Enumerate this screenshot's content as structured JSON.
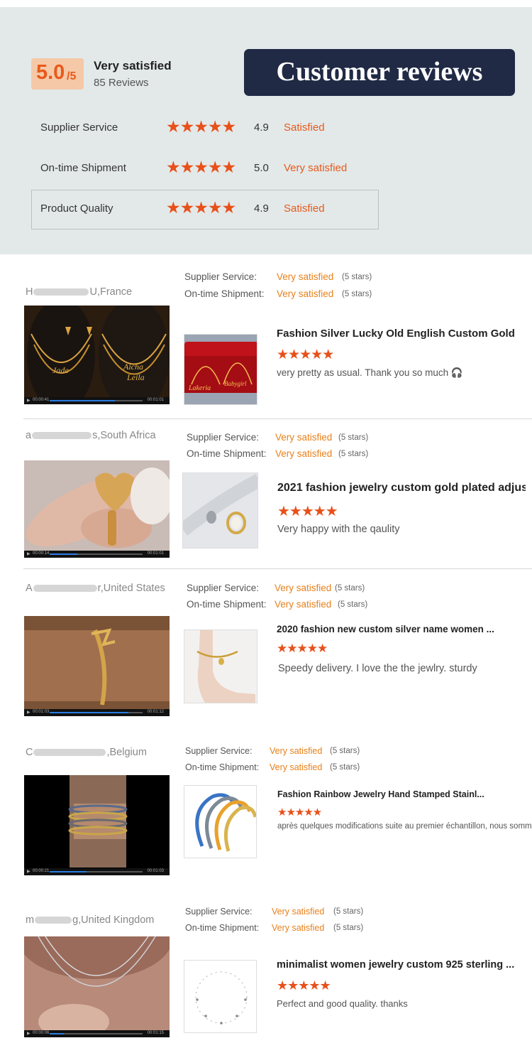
{
  "summary": {
    "score": "5.0",
    "score_suffix": "/5",
    "overall_label": "Very satisfied",
    "review_count": "85 Reviews",
    "banner": "Customer reviews",
    "ratings": [
      {
        "label": "Supplier Service",
        "stars": "★★★★★",
        "score": "4.9",
        "status": "Satisfied"
      },
      {
        "label": "On-time Shipment",
        "stars": "★★★★★",
        "score": "5.0",
        "status": "Very satisfied"
      },
      {
        "label": "Product Quality",
        "stars": "★★★★★",
        "score": "4.9",
        "status": "Satisfied"
      }
    ]
  },
  "reviews": [
    {
      "reviewer_initial": "H",
      "reviewer_tail": "U,France",
      "supplier_label": "Supplier Service:",
      "supplier_status": "Very satisfied",
      "supplier_stars": "(5 stars)",
      "shipment_label": "On-time Shipment:",
      "shipment_status": "Very satisfied",
      "shipment_stars": "(5 stars)",
      "product_title": "Fashion Silver Lucky Old English Custom Gold ...",
      "stars": "★★★★★",
      "comment": "very pretty as usual. Thank you so much 🎧",
      "video_start": "00:00:41",
      "video_end": "00:01:01",
      "video_progress": 0.7
    },
    {
      "reviewer_initial": "a",
      "reviewer_tail": "s,South Africa",
      "supplier_label": "Supplier Service:",
      "supplier_status": "Very satisfied",
      "supplier_stars": "(5 stars)",
      "shipment_label": "On-time Shipment:",
      "shipment_status": "Very satisfied",
      "shipment_stars": "(5 stars)",
      "product_title": "2021 fashion jewelry custom gold plated adjus...",
      "stars": "★★★★★",
      "comment": "Very happy with the qaulity",
      "video_start": "00:00:14",
      "video_end": "00:01:01",
      "video_progress": 0.3
    },
    {
      "reviewer_initial": "A",
      "reviewer_tail": "r,United States",
      "supplier_label": "Supplier Service:",
      "supplier_status": "Very satisfied",
      "supplier_stars": "(5 stars)",
      "shipment_label": "On-time Shipment:",
      "shipment_status": "Very satisfied",
      "shipment_stars": "(5 stars)",
      "product_title": "2020 fashion new custom silver name women ...",
      "stars": "★★★★★",
      "comment": "Speedy delivery. I love the the jewlry. sturdy",
      "video_start": "00:01:03",
      "video_end": "00:01:12",
      "video_progress": 0.85
    },
    {
      "reviewer_initial": "C",
      "reviewer_tail": ",Belgium",
      "supplier_label": "Supplier Service:",
      "supplier_status": "Very satisfied",
      "supplier_stars": "(5 stars)",
      "shipment_label": "On-time Shipment:",
      "shipment_status": "Very satisfied",
      "shipment_stars": "(5 stars)",
      "product_title": "Fashion Rainbow Jewelry Hand Stamped Stainl...",
      "stars": "★★★★★",
      "comment": "après quelques modifications suite au premier échantillon, nous sommes",
      "video_start": "00:00:21",
      "video_end": "00:01:03",
      "video_progress": 0.4
    },
    {
      "reviewer_initial": "m",
      "reviewer_tail": "g,United Kingdom",
      "supplier_label": "Supplier Service:",
      "supplier_status": "Very satisfied",
      "supplier_stars": "(5 stars)",
      "shipment_label": "On-time Shipment:",
      "shipment_status": "Very satisfied",
      "shipment_stars": "(5 stars)",
      "product_title": "minimalist women jewelry custom 925 sterling ...",
      "stars": "★★★★★",
      "comment": "Perfect and good quality. thanks",
      "video_start": "00:00:06",
      "video_end": "00:01:15",
      "video_progress": 0.15
    }
  ]
}
